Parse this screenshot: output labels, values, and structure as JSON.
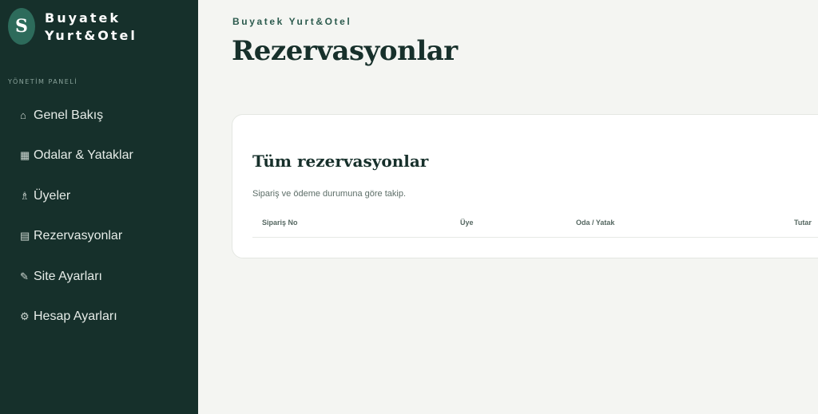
{
  "brand": {
    "logo_letter": "S",
    "name_line1": "Buyatek",
    "name_line2": "Yurt&Otel"
  },
  "sidebar": {
    "section_label": "YÖNETİM PANELİ",
    "items": [
      {
        "icon": "⌂",
        "label": "Genel Bakış"
      },
      {
        "icon": "▦",
        "label": "Odalar & Yataklar"
      },
      {
        "icon": "♗",
        "label": "Üyeler"
      },
      {
        "icon": "▤",
        "label": "Rezervasyonlar"
      },
      {
        "icon": "✎",
        "label": "Site Ayarları"
      },
      {
        "icon": "⚙",
        "label": "Hesap Ayarları"
      }
    ]
  },
  "header": {
    "eyebrow": "Buyatek Yurt&Otel",
    "title": "Rezervasyonlar"
  },
  "card": {
    "title": "Tüm rezervasyonlar",
    "subtitle": "Sipariş ve ödeme durumuna göre takip.",
    "columns": [
      "Sipariş No",
      "Üye",
      "Oda / Yatak",
      "Tutar"
    ]
  },
  "colors": {
    "sidebar_bg": "#16302b",
    "accent": "#2d6b5b",
    "page_bg": "#f4f5f2"
  }
}
